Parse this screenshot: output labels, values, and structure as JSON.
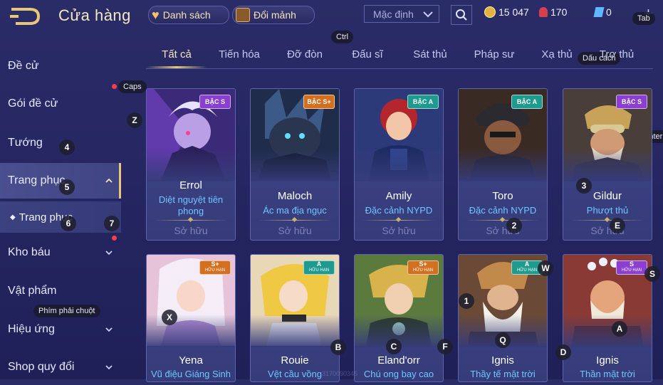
{
  "header": {
    "title": "Cửa hàng",
    "list_label": "Danh sách",
    "shards_label": "Đổi mảnh",
    "sort_value": "Mặc định",
    "gold": "15 047",
    "rubies": "170",
    "vouchers": "0"
  },
  "sidebar": {
    "items": [
      {
        "label": "Đề cử"
      },
      {
        "label": "Gói đề cử"
      },
      {
        "label": "Tướng"
      },
      {
        "label": "Trang phục"
      },
      {
        "label": "Trang phục"
      },
      {
        "label": "Kho báu"
      },
      {
        "label": "Vật phẩm"
      },
      {
        "label": "Hiệu ứng"
      },
      {
        "label": "Shop quy đổi"
      }
    ]
  },
  "tabs": [
    "Tất cả",
    "Tiến hóa",
    "Đỡ đòn",
    "Đấu sĩ",
    "Sát thủ",
    "Pháp sư",
    "Xạ thủ",
    "Trợ thủ"
  ],
  "cards": [
    {
      "hero": "Errol",
      "skin": "Diệt nguyệt tiên phong",
      "tier": "BẬC S",
      "tier_sub": "",
      "owned": "Sở hữu",
      "badge_color": "#8a3fd1",
      "art_color": "#6b3fb8"
    },
    {
      "hero": "Maloch",
      "skin": "Ác ma địa ngục",
      "tier": "BẬC S+",
      "tier_sub": "",
      "owned": "Sở hữu",
      "badge_color": "#d2701f",
      "art_color": "#2b3b66"
    },
    {
      "hero": "Amily",
      "skin": "Đặc cảnh NYPD",
      "tier": "BẬC A",
      "tier_sub": "",
      "owned": "Sở hữu",
      "badge_color": "#1f9a8e",
      "art_color": "#3a4a8a"
    },
    {
      "hero": "Toro",
      "skin": "Đặc cảnh NYPD",
      "tier": "BẬC A",
      "tier_sub": "",
      "owned": "Sở hữu",
      "badge_color": "#1f9a8e",
      "art_color": "#5a3a2a"
    },
    {
      "hero": "Gildur",
      "skin": "Phượt thủ",
      "tier": "BẬC S",
      "tier_sub": "",
      "owned": "Sở hữu",
      "badge_color": "#8a3fd1",
      "art_color": "#5c4a3a"
    },
    {
      "hero": "Yena",
      "skin": "Vũ điệu Giáng Sinh",
      "tier": "S+",
      "tier_sub": "HỮU HẠN",
      "owned": "",
      "badge_color": "#d2701f",
      "art_color": "#d8a2c2"
    },
    {
      "hero": "Rouie",
      "skin": "Vệt cầu vồng",
      "tier": "A",
      "tier_sub": "HỮU HẠN",
      "owned": "",
      "badge_color": "#1f9a8e",
      "art_color": "#e7c466"
    },
    {
      "hero": "Eland'orr",
      "skin": "Chú ong bay cao",
      "tier": "S+",
      "tier_sub": "HỮU HẠN",
      "owned": "",
      "badge_color": "#d2701f",
      "art_color": "#4f6a34"
    },
    {
      "hero": "Ignis",
      "skin": "Thầy tế mặt trời",
      "tier": "A",
      "tier_sub": "HỮU HẠN",
      "owned": "",
      "badge_color": "#1f9a8e",
      "art_color": "#8a5a3a"
    },
    {
      "hero": "Ignis",
      "skin": "Thần mặt trời",
      "tier": "S",
      "tier_sub": "HỮU HẠN",
      "owned": "",
      "badge_color": "#8a3fd1",
      "art_color": "#a04a3a"
    }
  ],
  "key_hints": {
    "tab": "Tab",
    "ctrl": "Ctrl",
    "space": "Dấu cách",
    "caps": "Caps",
    "enter": "Enter",
    "right_click": "Phím phải chuột",
    "k4": "4",
    "k5": "5",
    "k6": "6",
    "k7": "7",
    "kz": "Z",
    "k3": "3",
    "k2": "2",
    "ke": "E",
    "kw": "W",
    "ks": "S",
    "kx": "X",
    "kb": "B",
    "kc": "C",
    "kf": "F",
    "k1": "1",
    "kq": "Q",
    "kd": "D",
    "ka": "A"
  },
  "watermark": "3170090345"
}
